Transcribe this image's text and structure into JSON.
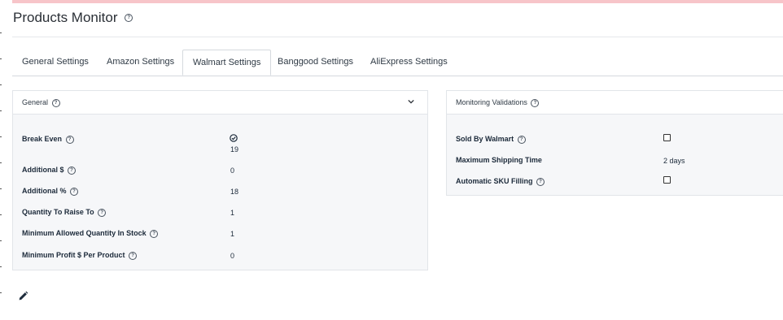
{
  "page": {
    "title": "Products Monitor"
  },
  "tabs": [
    {
      "label": "General Settings"
    },
    {
      "label": "Amazon Settings"
    },
    {
      "label": "Walmart Settings",
      "active": true
    },
    {
      "label": "Banggood Settings"
    },
    {
      "label": "AliExpress Settings"
    }
  ],
  "general": {
    "title": "General",
    "rows": [
      {
        "label": "Break Even",
        "value": "19",
        "icon": "check-circle-icon"
      },
      {
        "label": "Additional $",
        "value": "0"
      },
      {
        "label": "Additional %",
        "value": "18"
      },
      {
        "label": "Quantity To Raise To",
        "value": "1"
      },
      {
        "label": "Minimum Allowed Quantity In Stock",
        "value": "1"
      },
      {
        "label": "Minimum Profit $ Per Product",
        "value": "0"
      }
    ]
  },
  "validations": {
    "title": "Monitoring Validations",
    "rows": [
      {
        "label": "Sold By Walmart",
        "checked": false
      },
      {
        "label": "Maximum Shipping Time",
        "value": "2 days"
      },
      {
        "label": "Automatic SKU Filling",
        "checked": false
      }
    ]
  },
  "help_glyph": "?",
  "colors": {
    "top_bar": "#f7c5c9",
    "panel_bg": "#f6f7f9",
    "border": "#e2e5e9",
    "text": "#1c2a3a"
  }
}
